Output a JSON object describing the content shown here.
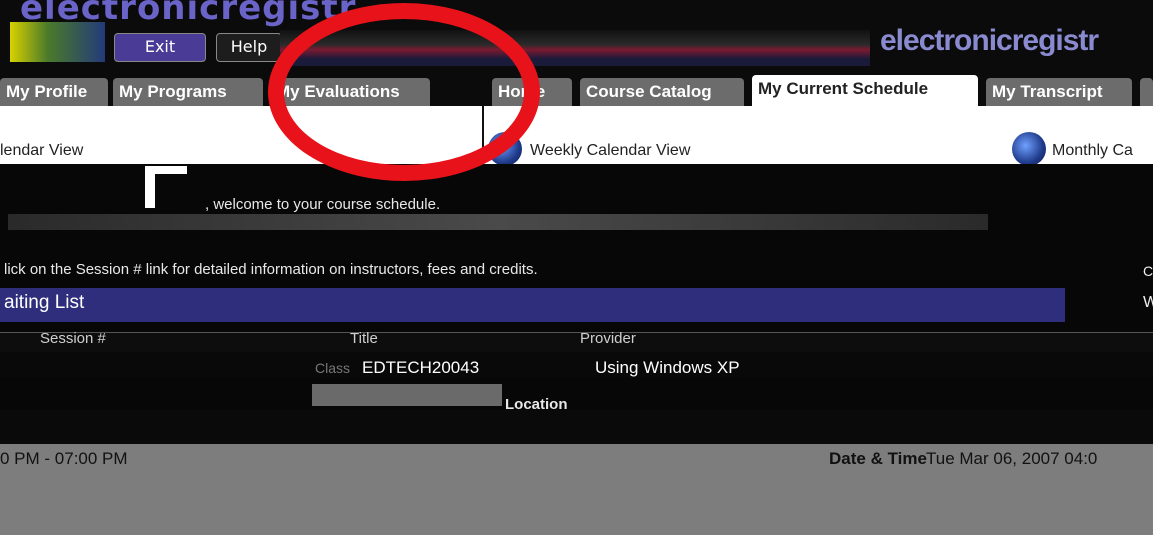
{
  "header": {
    "logo_text": "electronicregistr",
    "brand_right": "electronicregistr",
    "exit_label": "Exit",
    "help_label": "Help"
  },
  "tabs": [
    {
      "label": "My Profile",
      "active": false
    },
    {
      "label": "My Programs",
      "active": false
    },
    {
      "label": "My Evaluations",
      "active": false
    },
    {
      "label": "Home",
      "active": false
    },
    {
      "label": "Course Catalog",
      "active": false
    },
    {
      "label": "My Current Schedule",
      "active": true
    },
    {
      "label": "My Transcript",
      "active": false
    }
  ],
  "views": {
    "calendar_view": "lendar View",
    "weekly_view": "Weekly Calendar View",
    "monthly_view": "Monthly Ca"
  },
  "schedule": {
    "welcome": ", welcome to your course schedule.",
    "instructions": "lick on the Session # link for detailed information on instructors, fees and credits.",
    "waiting_list": "aiting List",
    "session_col": "Session #",
    "title_col": "Title",
    "provider_col": "Provider",
    "session_prefix": "Class",
    "session_code": "EDTECH20043",
    "course_name": "Using Windows XP",
    "location_label": "Location",
    "time_range": "0 PM - 07:00 PM",
    "datetime_label": "Date & Time",
    "datetime_value": "Tue Mar 06, 2007  04:0"
  },
  "annotation": {
    "color": "#e8121a"
  },
  "colors": {
    "banner": "#0b0b0b",
    "waiting_bar": "#2e2e7c",
    "exit_button": "#4a3c96"
  }
}
